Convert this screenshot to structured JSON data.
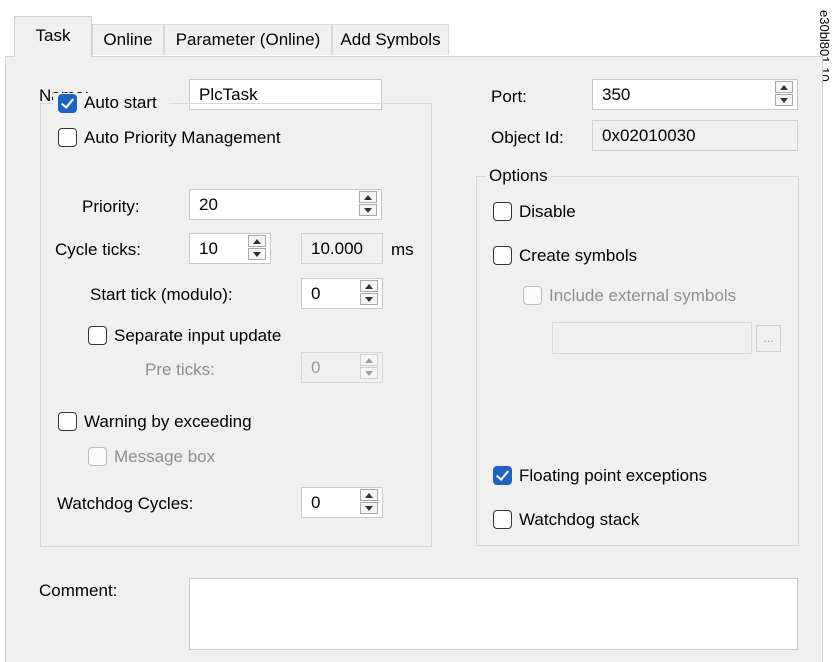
{
  "tabs": [
    "Task",
    "Online",
    "Parameter (Online)",
    "Add Symbols"
  ],
  "side_label": "e30bl801.10",
  "left": {
    "name_label": "Name:",
    "name_value": "PlcTask",
    "auto_start": {
      "label": "Auto start",
      "checked": true
    },
    "auto_priority": {
      "label": "Auto Priority Management",
      "checked": false
    },
    "priority_label": "Priority:",
    "priority_value": "20",
    "cycle_label": "Cycle ticks:",
    "cycle_value": "10",
    "cycle_time": "10.000",
    "cycle_unit": "ms",
    "start_tick_label": "Start tick (modulo):",
    "start_tick_value": "0",
    "separate_input": {
      "label": "Separate input update",
      "checked": false
    },
    "pre_ticks_label": "Pre ticks:",
    "pre_ticks_value": "0",
    "warning": {
      "label": "Warning by exceeding",
      "checked": false
    },
    "message_box": {
      "label": "Message box",
      "checked": false
    },
    "watchdog_label": "Watchdog Cycles:",
    "watchdog_value": "0"
  },
  "right": {
    "port_label": "Port:",
    "port_value": "350",
    "object_id_label": "Object Id:",
    "object_id_value": "0x02010030",
    "options_title": "Options",
    "disable": {
      "label": "Disable",
      "checked": false
    },
    "create_symbols": {
      "label": "Create symbols",
      "checked": false
    },
    "include_external": {
      "label": "Include external symbols",
      "checked": false
    },
    "path_value": "",
    "browse_label": "...",
    "floating_point": {
      "label": "Floating point exceptions",
      "checked": true
    },
    "watchdog_stack": {
      "label": "Watchdog stack",
      "checked": false
    }
  },
  "comment_label": "Comment:",
  "comment_value": ""
}
